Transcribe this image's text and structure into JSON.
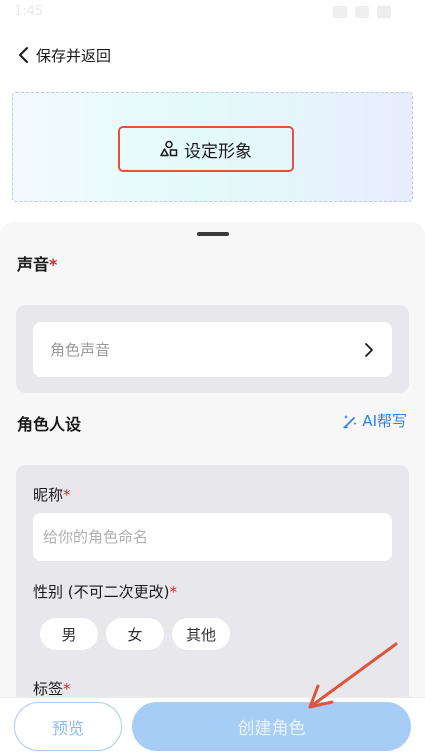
{
  "status_bar": {
    "time": "1:45"
  },
  "header": {
    "back_label": "保存并返回"
  },
  "avatar": {
    "set_image_label": "设定形象"
  },
  "voice": {
    "section_title": "声音",
    "required_mark": "*",
    "select_placeholder": "角色声音"
  },
  "persona": {
    "section_title": "角色人设",
    "ai_help_label": "AI帮写",
    "nickname_label": "昵称",
    "nickname_required": "*",
    "nickname_placeholder": "给你的角色命名",
    "gender_label": "性别 (不可二次更改)",
    "gender_required": "*",
    "gender_options": [
      "男",
      "女",
      "其他"
    ],
    "tags_label": "标签",
    "tags_required": "*"
  },
  "footer": {
    "preview_label": "预览",
    "create_label": "创建角色"
  },
  "colors": {
    "accent_blue": "#2f7fe4",
    "required_red": "#e02828",
    "highlight_red": "#e0533f",
    "create_button": "#a7cdf7"
  },
  "icons": {
    "back": "chevron-left-icon",
    "set_image": "person-shapes-icon",
    "voice_select": "chevron-right-icon",
    "ai_help": "pen-sparkle-icon"
  }
}
